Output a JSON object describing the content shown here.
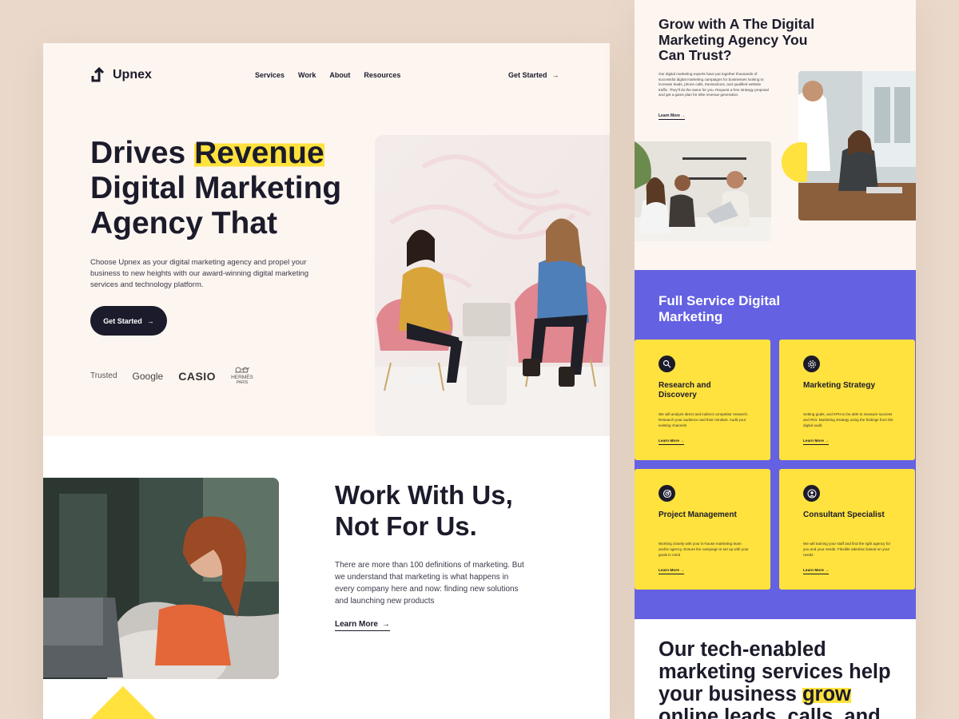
{
  "colors": {
    "accent_yellow": "#ffe23d",
    "purple": "#6461e2",
    "dark": "#1b1b2b",
    "cream": "#fdf5f0"
  },
  "nav": {
    "brand": "Upnex",
    "links": [
      "Services",
      "Work",
      "About",
      "Resources"
    ],
    "cta": "Get Started",
    "arrow": "→"
  },
  "hero": {
    "title_pre": "Drives ",
    "title_highlight": "Revenue",
    "title_post": " Digital Marketing Agency That",
    "description": "Choose Upnex as your digital marketing agency and propel your business to new heights with our award-winning digital marketing services and technology platform.",
    "button": "Get Started",
    "trusted_label": "Trusted",
    "brands": {
      "google": "Google",
      "casio": "CASIO",
      "hermes": "HERMÈS",
      "hermes_sub": "PARIS"
    }
  },
  "work": {
    "title": "Work With Us, Not For Us.",
    "description": "There are more than 100 definitions of marketing. But we understand that marketing is what happens in every company here and now: finding new solutions and launching new products",
    "link": "Learn More"
  },
  "right_intro": {
    "title": "Grow with A The Digital Marketing Agency You Can Trust?",
    "description": "Our digital marketing experts have put together thousands of successful digital marketing campaigns for businesses looking to increase leads, phone calls, transactions, and qualified website traffic. They'll do the same for you. Request a free strategy proposal and get a game plan for elite revenue generation.",
    "link": "Learn More"
  },
  "services": {
    "title": "Full Service Digital Marketing",
    "cards": [
      {
        "title": "Research and Discovery",
        "icon": "search-icon",
        "description": "We will analyze direct and indirect competitor research. Research your audience and their mindset. Audit your existing channels",
        "link": "Learn More"
      },
      {
        "title": "Marketing Strategy",
        "icon": "gear-icon",
        "description": "Setting goals, and KPIs to be able to measure success and ROI. Marketing strategy using the findings from the digital audit.",
        "link": "Learn More"
      },
      {
        "title": "Project Management",
        "icon": "target-icon",
        "description": "Working closely with your in-house marketing team and/or agency. Ensure the campaign is set up with your goals in mind",
        "link": "Learn More"
      },
      {
        "title": "Consultant Specialist",
        "icon": "user-icon",
        "description": "We will training your staff and find the right agency for you and your needs. Flexible attention based on your needs",
        "link": "Learn More"
      }
    ]
  },
  "tech": {
    "pre": "Our tech-enabled marketing services help your business ",
    "highlight": "grow",
    "post": " online leads, calls, and"
  }
}
